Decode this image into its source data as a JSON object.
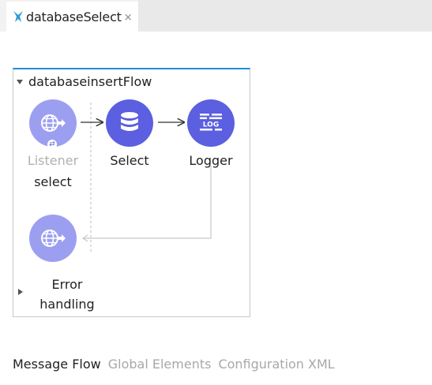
{
  "editor": {
    "tab_title": "databaseSelect",
    "close_glyph": "×"
  },
  "flow": {
    "name": "databaseinsertFlow",
    "nodes": [
      {
        "id": "listener",
        "icon": "http-globe-icon",
        "label": "Listener",
        "sublabel": "select"
      },
      {
        "id": "select",
        "icon": "database-icon",
        "label": "Select"
      },
      {
        "id": "logger",
        "icon": "log-icon",
        "label": "Logger"
      }
    ],
    "error_handling": {
      "icon": "http-globe-icon",
      "label_line1": "Error",
      "label_line2": "handling"
    },
    "source_badge_glyph": "⇄"
  },
  "bottom_tabs": [
    {
      "label": "Message Flow",
      "active": true
    },
    {
      "label": "Global Elements",
      "active": false
    },
    {
      "label": "Configuration XML",
      "active": false
    }
  ],
  "colors": {
    "node": "#5b5fe0",
    "node_faded": "#9c9ff0",
    "flow_accent": "#1f8fd6"
  }
}
